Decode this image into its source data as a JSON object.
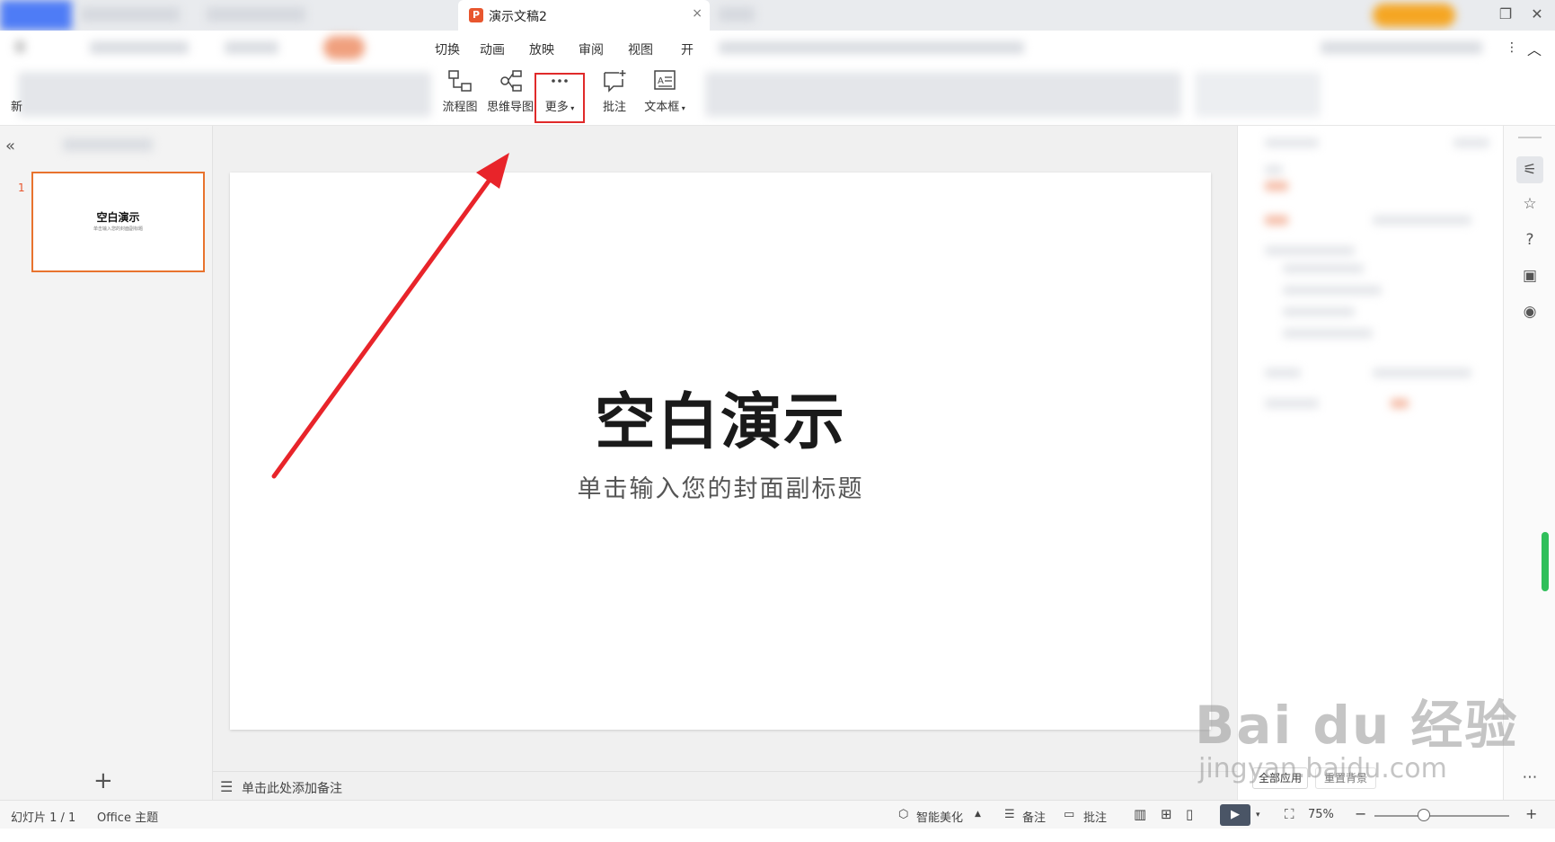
{
  "title_bar": {
    "doc_tab_icon": "P",
    "doc_tab_title": "演示文稿2",
    "doc_tab_close": "×"
  },
  "menu_tabs": [
    "切换",
    "动画",
    "放映",
    "审阅",
    "视图",
    "开"
  ],
  "ribbon": {
    "flowchart_label": "流程图",
    "mindmap_label": "思维导图",
    "more_label": "更多",
    "comment_label": "批注",
    "textbox_label": "文本框"
  },
  "left_panel": {
    "collapse": "«",
    "slide_number": "1",
    "add_slide": "+"
  },
  "slide": {
    "title": "空白演示",
    "subtitle": "单击输入您的封面副标题",
    "thumb_subtitle": "单击输入您的封面副标题"
  },
  "notes": {
    "placeholder": "单击此处添加备注"
  },
  "right_pane": {
    "apply_all": "全部应用",
    "reset_background": "重置背景"
  },
  "status_bar": {
    "slide_counter": "幻灯片 1 / 1",
    "theme": "Office 主题",
    "smart_beautify": "智能美化",
    "notes": "备注",
    "comments": "批注",
    "zoom": "75%"
  },
  "watermark": {
    "brand": "Bai du 经验",
    "url": "jingyan.baidu.com"
  },
  "colors": {
    "accent_orange": "#e8732e",
    "highlight_red": "#e02a2a",
    "arrow_red": "#e8242a"
  }
}
